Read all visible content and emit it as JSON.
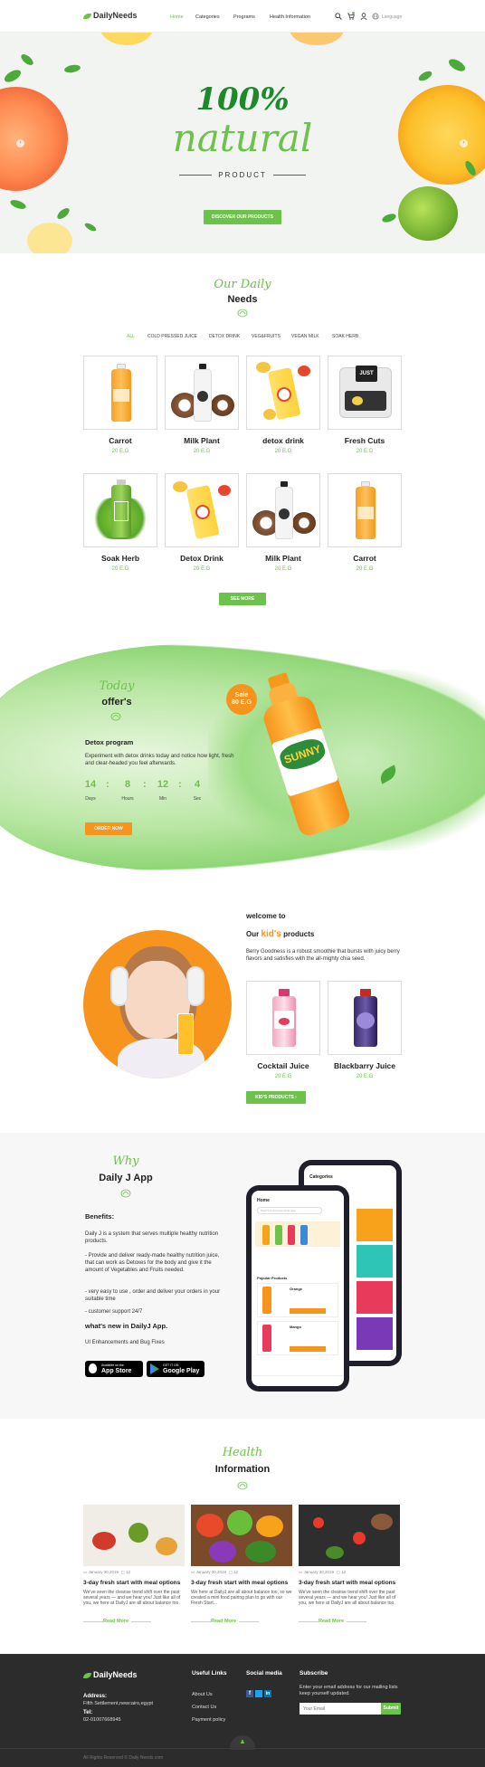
{
  "header": {
    "logo": "DailyNeeds",
    "nav": [
      "Home",
      "Categories",
      "Programs",
      "Health Information"
    ],
    "language": "Language"
  },
  "hero": {
    "line1": "100%",
    "line2": "natural",
    "line3": "PRODUCT",
    "cta": "DISCOVER OUR PRODUCTS"
  },
  "needs": {
    "script": "Our Daily",
    "title": "Needs",
    "filters": [
      "ALL",
      "COLD PRESSED JUICE",
      "DETOX DRINK",
      "VEG&FRUITS",
      "VEGAN MILK",
      "SOAK HERB"
    ],
    "products": [
      {
        "name": "Carrot",
        "price": "20 E.G"
      },
      {
        "name": "Milk Plant",
        "price": "20 E.G"
      },
      {
        "name": "detox drink",
        "price": "20 E.G"
      },
      {
        "name": "Fresh Cuts",
        "price": "20 E.G"
      },
      {
        "name": "Soak Herb",
        "price": "20 E.G"
      },
      {
        "name": "Detox Drink",
        "price": "20 E.G"
      },
      {
        "name": "Milk Plant",
        "price": "20 E.G"
      },
      {
        "name": "Carrot",
        "price": "20 E.G"
      }
    ],
    "see_more": "SEE MORE"
  },
  "offers": {
    "script": "Today",
    "title": "offer's",
    "program": "Detox program",
    "text": "Experiment with detox drinks today and notice how light, fresh and clear-headed you feel afterwards.",
    "countdown": [
      {
        "value": "14",
        "label": "Days"
      },
      {
        "value": "8",
        "label": "Hours"
      },
      {
        "value": "12",
        "label": "Min"
      },
      {
        "value": "4",
        "label": "Sec"
      }
    ],
    "cta": "ORDER NOW",
    "sale_line1": "Sale",
    "sale_line2": "80 E.G",
    "bottle_label": "SUNNY"
  },
  "kids": {
    "welcome": "welcome to",
    "our": "Our",
    "kids_word": "kid's",
    "products_word": "products",
    "text": "Berry Goodness is a robust smoothie that bursts with juicy berry flavors and satisfies with the all-mighty chia seed.",
    "items": [
      {
        "name": "Cocktail Juice",
        "price": "20 E.G"
      },
      {
        "name": "Blackbarry Juice",
        "price": "20 E.G"
      }
    ],
    "cta": "KID'S PRODUCTS"
  },
  "app": {
    "script": "Why",
    "title": "Daily J App",
    "benefits_title": "Benefits:",
    "benefits": [
      "Daily J is a system that serves multiple healthy nutrition products.",
      "- Provide and deliver ready-made healthy nutrition juice, that can work as Detoxes for the body and give it the amount of Vegetables and Fruits needed.",
      "- very easy to use , order and deliver your orders in your suitable time",
      "- customer support 24/7"
    ],
    "new_title": "what's new in DailyJ App.",
    "new_text": "UI Enhancements and Bug Fixes",
    "appstore_small": "Available on the",
    "appstore": "App Store",
    "googleplay_small": "GET IT ON",
    "googleplay": "Google Play",
    "phone_home": "Home",
    "phone_categories": "Categories",
    "phone_search": "Search to find new drink type",
    "phone_popular": "Popular Products",
    "phone_items": [
      "Orange",
      "Mango"
    ]
  },
  "health": {
    "script": "Health",
    "title": "Information",
    "posts": [
      {
        "date": "January 30,2019",
        "comments": "12",
        "title": "3-day fresh start with meal options",
        "text": "We've seen the cleanse trend shift over the past several years — and we hear you! Just like all of you, we here at DailyJ are all about balance too.",
        "more": "Read More"
      },
      {
        "date": "January 30,2019",
        "comments": "12",
        "title": "3-day fresh start with meal options",
        "text": "We here at DailyJ are all about balance too, so we created a mini food pairing plan to go with our Fresh Start...",
        "more": "Read More"
      },
      {
        "date": "January 30,2019",
        "comments": "12",
        "title": "3-day fresh start with meal options",
        "text": "We've seen the cleanse trend shift over the past several years — and we hear you! Just like all of you, we here at DailyJ are all about balance too.",
        "more": "Read More"
      }
    ]
  },
  "footer": {
    "logo": "DailyNeeds",
    "address_label": "Address:",
    "address": "Fifth Settlement,newcairo,egypt",
    "tel_label": "Tel:",
    "tel": "02-01007668945",
    "links_title": "Useful Links",
    "links": [
      "About Us",
      "Contact Us",
      "Payment policy"
    ],
    "social_title": "Social media",
    "subscribe_title": "Subscribe",
    "subscribe_text": "Enter your email address for our mailing lists keep yourself updated.",
    "email_placeholder": "Your Email",
    "subscribe_btn": "Submit",
    "copyright": "All Rights Reserved © Daily Needs.com"
  },
  "colors": {
    "accent": "#6cc24a",
    "orange": "#f7941d",
    "footer": "#2c2c2c"
  }
}
